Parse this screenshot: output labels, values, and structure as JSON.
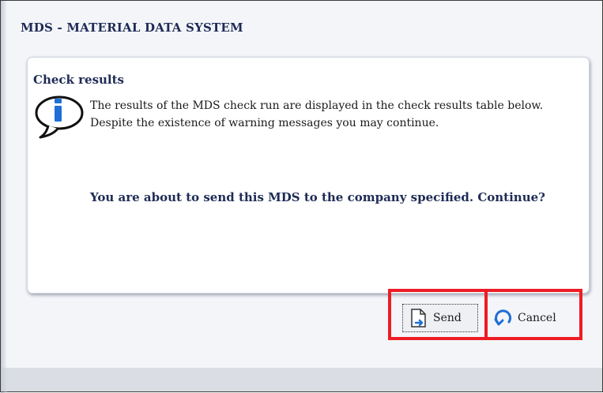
{
  "window": {
    "title": "MDS - MATERIAL DATA SYSTEM"
  },
  "panel": {
    "title": "Check results",
    "message_lines": [
      "The results of the MDS check run are displayed in the check results table below.",
      "Despite the existence of warning messages you may continue."
    ],
    "question": "You are about to send this MDS to the company specified. Continue?",
    "icon": "info-icon"
  },
  "buttons": {
    "send_label": "Send",
    "send_icon": "send-document-icon",
    "cancel_label": "Cancel",
    "cancel_icon": "undo-icon"
  },
  "colors": {
    "highlight": "#ee1c25",
    "title_text": "#1e2b55",
    "accent_blue": "#1f6fd6"
  }
}
